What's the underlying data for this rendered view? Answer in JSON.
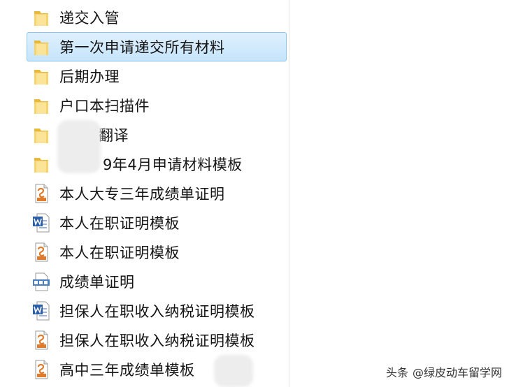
{
  "items": [
    {
      "label": "递交入管",
      "type": "folder",
      "selected": false
    },
    {
      "label": "第一次申请递交所有材料",
      "type": "folder",
      "selected": true
    },
    {
      "label": "后期办理",
      "type": "folder",
      "selected": false
    },
    {
      "label": "户口本扫描件",
      "type": "folder",
      "selected": false
    },
    {
      "label": "翻译",
      "type": "folder",
      "selected": false
    },
    {
      "label": "9年4月申请材料模板",
      "type": "folder",
      "selected": false
    },
    {
      "label": "本人大专三年成绩单证明",
      "type": "pdf",
      "selected": false
    },
    {
      "label": "本人在职证明模板",
      "type": "word",
      "selected": false
    },
    {
      "label": "本人在职证明模板",
      "type": "pdf",
      "selected": false
    },
    {
      "label": "成绩单证明",
      "type": "jpg",
      "selected": false
    },
    {
      "label": "担保人在职收入纳税证明模板",
      "type": "word",
      "selected": false
    },
    {
      "label": "担保人在职收入纳税证明模板",
      "type": "pdf",
      "selected": false
    },
    {
      "label": "高中三年成绩单模板",
      "type": "pdf",
      "selected": false
    }
  ],
  "watermark": {
    "brand": "头条",
    "handle": "@绿皮动车留学网"
  },
  "colors": {
    "selection_bg": "#c6e4fb",
    "selection_border": "#8fc4ec",
    "folder": "#f2c94c",
    "word_blue": "#2c5ea8",
    "pdf_orange": "#e07b2b"
  }
}
